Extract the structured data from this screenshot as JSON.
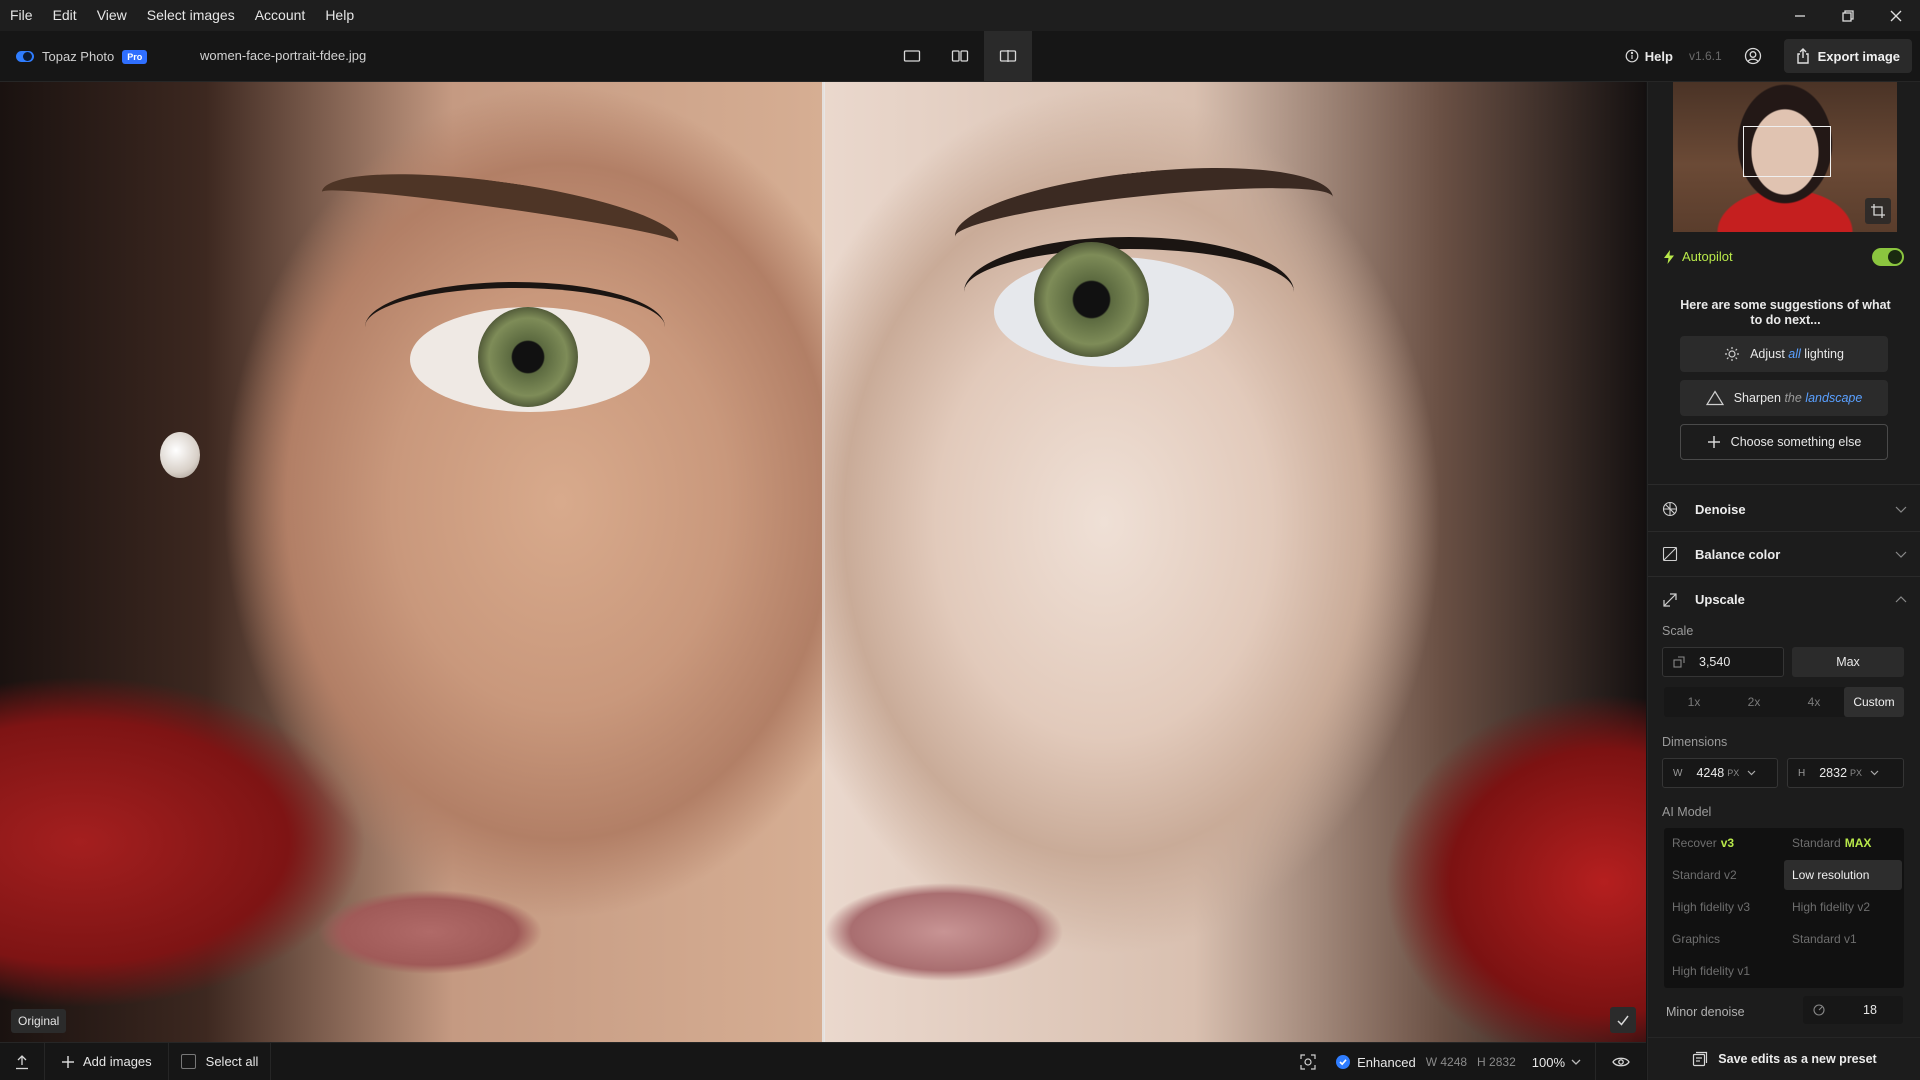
{
  "menu": {
    "items": [
      "File",
      "Edit",
      "View",
      "Select images",
      "Account",
      "Help"
    ]
  },
  "window_controls": [
    "minimize-icon",
    "restore-icon",
    "close-icon"
  ],
  "toolbar": {
    "brand_name": "Topaz Photo",
    "brand_badge": "Pro",
    "filename": "women-face-portrait-fdee.jpg",
    "view_modes": [
      "single-view-icon",
      "side-by-side-icon",
      "split-view-icon"
    ],
    "active_view_mode": "split-view-icon",
    "help_label": "Help",
    "version": "v1.6.1",
    "export_label": "Export image"
  },
  "canvas": {
    "original_label": "Original"
  },
  "bottombar": {
    "add_images_label": "Add images",
    "select_all_label": "Select all",
    "enhanced_label": "Enhanced",
    "width_label": "W 4248",
    "height_label": "H 2832",
    "zoom": "100%"
  },
  "panel": {
    "autopilot": {
      "label": "Autopilot",
      "enabled": true,
      "prompt": "Here are some suggestions of what to do next...",
      "suggestions": [
        {
          "pre": "Adjust",
          "em": "all",
          "post": "lighting",
          "icon": "sun-icon"
        },
        {
          "pre": "Sharpen",
          "mid": "the",
          "em": "landscape",
          "icon": "triangle-icon"
        },
        {
          "label": "Choose something else",
          "icon": "plus-icon"
        }
      ]
    },
    "sections": {
      "denoise": "Denoise",
      "balance_color": "Balance color",
      "upscale": "Upscale"
    },
    "upscale": {
      "scale_label": "Scale",
      "scale_value": "3,540",
      "max_label": "Max",
      "scale_options": [
        "1x",
        "2x",
        "4x",
        "Custom"
      ],
      "selected_scale": "Custom",
      "dimensions_label": "Dimensions",
      "width_prefix": "W",
      "width_value": "4248",
      "height_prefix": "H",
      "height_value": "2832",
      "unit": "PX",
      "ai_model_label": "AI Model",
      "models": [
        {
          "name": "Recover",
          "tag": "v3"
        },
        {
          "name": "Standard",
          "tag": "MAX"
        },
        {
          "name": "Standard v2"
        },
        {
          "name": "Low resolution",
          "selected": true
        },
        {
          "name": "High fidelity v3"
        },
        {
          "name": "High fidelity v2"
        },
        {
          "name": "Graphics"
        },
        {
          "name": "Standard v1"
        },
        {
          "name": "High fidelity v1"
        }
      ],
      "minor_denoise_label": "Minor denoise",
      "minor_denoise_value": "18"
    },
    "save_preset_label": "Save edits as a new preset"
  },
  "colors": {
    "accent_blue": "#2f7dff",
    "autopilot_green": "#b8e84a",
    "toggle_green": "#8bc53f"
  }
}
